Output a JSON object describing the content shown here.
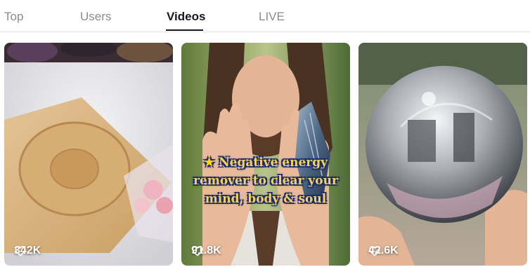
{
  "tabs": [
    {
      "label": "Top",
      "active": false
    },
    {
      "label": "Users",
      "active": false
    },
    {
      "label": "Videos",
      "active": true
    },
    {
      "label": "LIVE",
      "active": false
    }
  ],
  "videos": [
    {
      "likes": "342K",
      "thumbnail": "wooden-crystal-stand"
    },
    {
      "likes": "91.8K",
      "thumbnail": "man-holding-crystal",
      "caption_lines": [
        "Negative energy",
        "remover to clear your",
        "mind, body & soul"
      ],
      "caption_icon": "star-emoji"
    },
    {
      "likes": "42.6K",
      "thumbnail": "crystal-ball"
    }
  ],
  "colors": {
    "active_tab": "#161823",
    "inactive_tab": "#8a8b91",
    "caption_text": "#f3d35b",
    "caption_outline": "#1e2b6b"
  }
}
